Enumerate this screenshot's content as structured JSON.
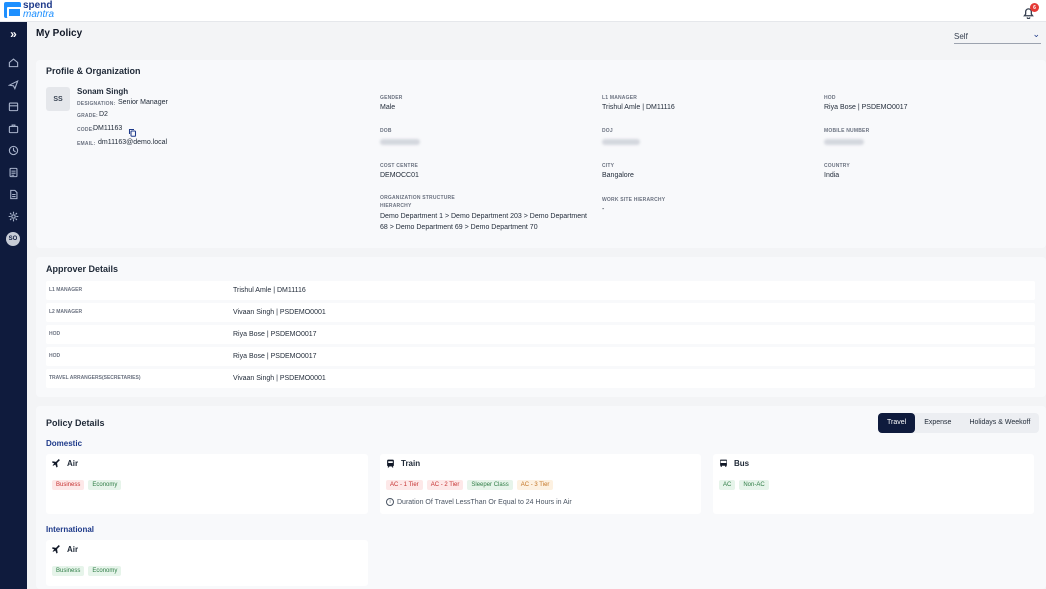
{
  "app": {
    "logo_line1": "spend",
    "logo_line2": "mantra",
    "notification_count": "6"
  },
  "page": {
    "title": "My Policy",
    "selector_value": "Self"
  },
  "sidebar": {
    "avatar_initials": "SO"
  },
  "profile": {
    "section_title": "Profile & Organization",
    "initials": "SS",
    "name": "Sonam Singh",
    "designation_label": "DESIGNATION:",
    "designation": "Senior Manager",
    "grade_label": "GRADE:",
    "grade": "D2",
    "code_label": "CODE:",
    "code": "DM11163",
    "email_label": "EMAIL:",
    "email": "dm11163@demo.local",
    "fields": {
      "gender_label": "GENDER",
      "gender": "Male",
      "l1_label": "L1 MANAGER",
      "l1": "Trishul Amle | DM11116",
      "hod_label": "HOD",
      "hod": "Riya Bose | PSDEMO0017",
      "dob_label": "DOB",
      "doj_label": "DOJ",
      "mobile_label": "MOBILE NUMBER",
      "cost_centre_label": "COST CENTRE",
      "cost_centre": "DEMOCC01",
      "city_label": "CITY",
      "city": "Bangalore",
      "country_label": "COUNTRY",
      "country": "India",
      "org_label_1": "ORGANIZATION STRUCTURE",
      "org_label_2": "HIERARCHY",
      "org_line1": "Demo Department 1 > Demo Department 203 > Demo Department",
      "org_line2": "68 > Demo Department 69 > Demo Department 70",
      "worksite_label": "WORK SITE HIERARCHY",
      "worksite": "-"
    }
  },
  "approvers": {
    "section_title": "Approver Details",
    "rows": [
      {
        "label": "L1 MANAGER",
        "value": "Trishul Amle | DM11116"
      },
      {
        "label": "L2 MANAGER",
        "value": "Vivaan Singh | PSDEMO0001"
      },
      {
        "label": "HOD",
        "value": "Riya Bose | PSDEMO0017"
      },
      {
        "label": "HOD",
        "value": "Riya Bose | PSDEMO0017"
      },
      {
        "label": "TRAVEL ARRANGERS(SECRETARIES)",
        "value": "Vivaan Singh | PSDEMO0001"
      }
    ]
  },
  "policy": {
    "section_title": "Policy Details",
    "tabs": [
      "Travel",
      "Expense",
      "Holidays & Weekoff"
    ],
    "active_tab": "Travel",
    "domestic_label": "Domestic",
    "international_label": "International",
    "domestic": {
      "air": {
        "title": "Air",
        "chips": [
          "Business",
          "Economy"
        ]
      },
      "train": {
        "title": "Train",
        "chips": [
          "AC - 1 Tier",
          "AC - 2 Tier",
          "Sleeper Class",
          "AC - 3 Tier"
        ],
        "note": "Duration Of Travel LessThan Or Equal to 24 Hours in Air"
      },
      "bus": {
        "title": "Bus",
        "chips": [
          "AC",
          "Non-AC"
        ]
      }
    },
    "international": {
      "air": {
        "title": "Air",
        "chips": [
          "Business",
          "Economy"
        ]
      }
    }
  }
}
